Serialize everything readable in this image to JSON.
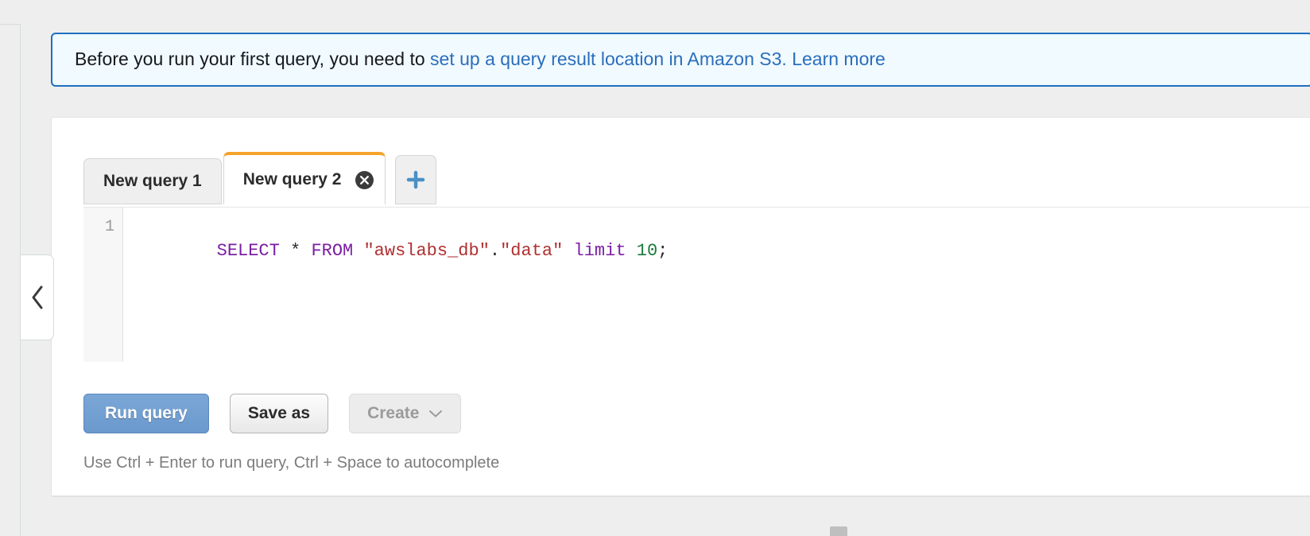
{
  "banner": {
    "icon": "none",
    "text_prefix": "Before you run your first query, you need to ",
    "link_text": "set up a query result location in Amazon S3. Learn more",
    "link_color": "#2a6ebb",
    "background_color": "#f1faff",
    "border_color": "#1f6fbf"
  },
  "sidebar": {
    "collapse_icon": "chevron-left-icon"
  },
  "editor_panel": {
    "tabs": [
      {
        "label": "New query 1",
        "active": false,
        "closable": false
      },
      {
        "label": "New query 2",
        "active": true,
        "closable": true,
        "close_icon": "close-circle-icon"
      }
    ],
    "add_tab": {
      "icon": "plus-icon",
      "color": "#4a90c4"
    },
    "active_tab_accent": "#f6a32b",
    "gutter": {
      "line_numbers": [
        "1"
      ]
    },
    "query": {
      "full_text": "SELECT * FROM \"awslabs_db\".\"data\" limit 10;",
      "tokens": [
        {
          "text": "SELECT",
          "type": "keyword"
        },
        {
          "text": " ",
          "type": "plain"
        },
        {
          "text": "*",
          "type": "operator"
        },
        {
          "text": " ",
          "type": "plain"
        },
        {
          "text": "FROM",
          "type": "keyword"
        },
        {
          "text": " ",
          "type": "plain"
        },
        {
          "text": "\"awslabs_db\"",
          "type": "string"
        },
        {
          "text": ".",
          "type": "punctuation"
        },
        {
          "text": "\"data\"",
          "type": "string"
        },
        {
          "text": " ",
          "type": "plain"
        },
        {
          "text": "limit",
          "type": "keyword"
        },
        {
          "text": " ",
          "type": "plain"
        },
        {
          "text": "10",
          "type": "number"
        },
        {
          "text": ";",
          "type": "punctuation"
        }
      ]
    },
    "buttons": {
      "run_query": "Run query",
      "save_as": "Save as",
      "create": "Create",
      "create_caret_icon": "chevron-down-icon",
      "create_disabled": true
    },
    "hint": "Use Ctrl + Enter to run query, Ctrl + Space to autocomplete"
  },
  "colors": {
    "page_background": "#eeeeee",
    "panel_background": "#ffffff",
    "primary_button": "#6b99cd",
    "tab_accent": "#f6a32b"
  }
}
